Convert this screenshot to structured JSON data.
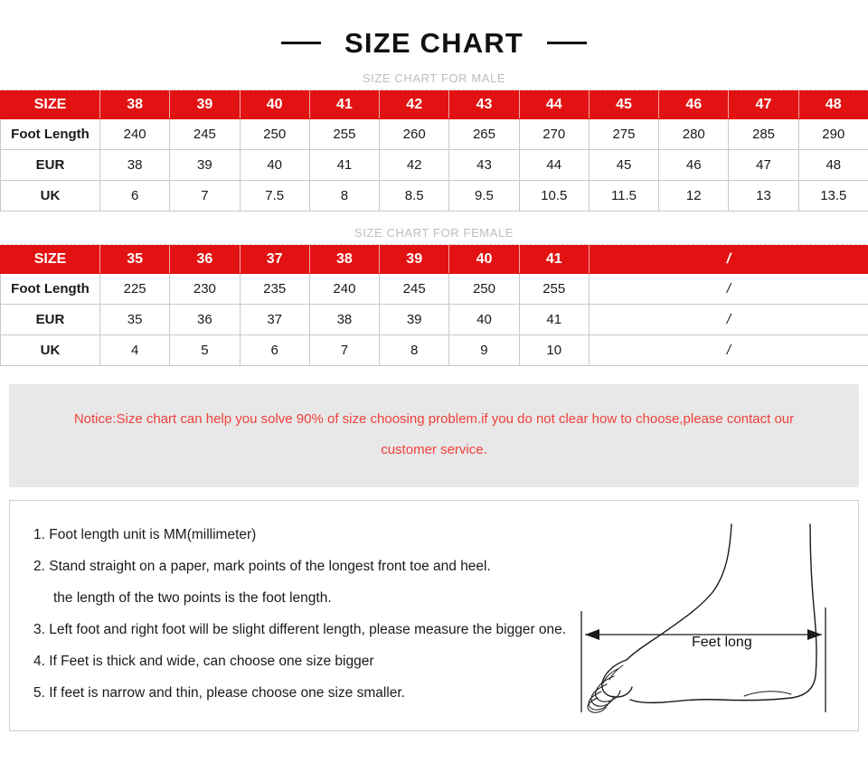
{
  "header": {
    "title": "SIZE CHART",
    "left_dash": "dash",
    "right_dash": "dash"
  },
  "male_section": {
    "caption": "SIZE CHART FOR MALE"
  },
  "female_section": {
    "caption": "SIZE CHART FOR FEMALE"
  },
  "notice": {
    "line1": "Notice:Size chart can help you solve 90% of size choosing problem.if you do not clear how to choose,please contact our",
    "line2": "customer service.",
    "color": "#f0403a"
  },
  "instructions": {
    "items": [
      "1. Foot length unit is MM(millimeter)",
      "2. Stand straight on a paper, mark points of the longest front toe and heel.",
      "the length of the two points is the foot length.",
      "3. Left foot and right foot will be slight different length, please measure the bigger one.",
      "4. If Feet is thick and wide, can choose one size bigger",
      "5. If feet is narrow and thin, please choose one size smaller."
    ]
  },
  "diagram": {
    "label": "Feet long",
    "icon": "foot-side-profile-icon"
  },
  "colors": {
    "header_red": "#e31212",
    "notice_red": "#f0403a",
    "notice_bg": "#e8e8e8",
    "border_gray": "#c9c9c9"
  },
  "chart_data": [
    {
      "type": "table",
      "title": "SIZE CHART FOR MALE",
      "row_headers": [
        "SIZE",
        "Foot Length",
        "EUR",
        "UK"
      ],
      "categories": [
        "38",
        "39",
        "40",
        "41",
        "42",
        "43",
        "44",
        "45",
        "46",
        "47",
        "48"
      ],
      "series": [
        {
          "name": "Foot Length",
          "values": [
            "240",
            "245",
            "250",
            "255",
            "260",
            "265",
            "270",
            "275",
            "280",
            "285",
            "290"
          ]
        },
        {
          "name": "EUR",
          "values": [
            "38",
            "39",
            "40",
            "41",
            "42",
            "43",
            "44",
            "45",
            "46",
            "47",
            "48"
          ]
        },
        {
          "name": "UK",
          "values": [
            "6",
            "7",
            "7.5",
            "8",
            "8.5",
            "9.5",
            "10.5",
            "11.5",
            "12",
            "13",
            "13.5"
          ]
        }
      ]
    },
    {
      "type": "table",
      "title": "SIZE CHART FOR FEMALE",
      "row_headers": [
        "SIZE",
        "Foot Length",
        "EUR",
        "UK"
      ],
      "categories": [
        "35",
        "36",
        "37",
        "38",
        "39",
        "40",
        "41"
      ],
      "merged_trailing_cell": "/",
      "merged_trailing_span": 4,
      "series": [
        {
          "name": "Foot Length",
          "values": [
            "225",
            "230",
            "235",
            "240",
            "245",
            "250",
            "255"
          ]
        },
        {
          "name": "EUR",
          "values": [
            "35",
            "36",
            "37",
            "38",
            "39",
            "40",
            "41"
          ]
        },
        {
          "name": "UK",
          "values": [
            "4",
            "5",
            "6",
            "7",
            "8",
            "9",
            "10"
          ]
        }
      ]
    }
  ]
}
